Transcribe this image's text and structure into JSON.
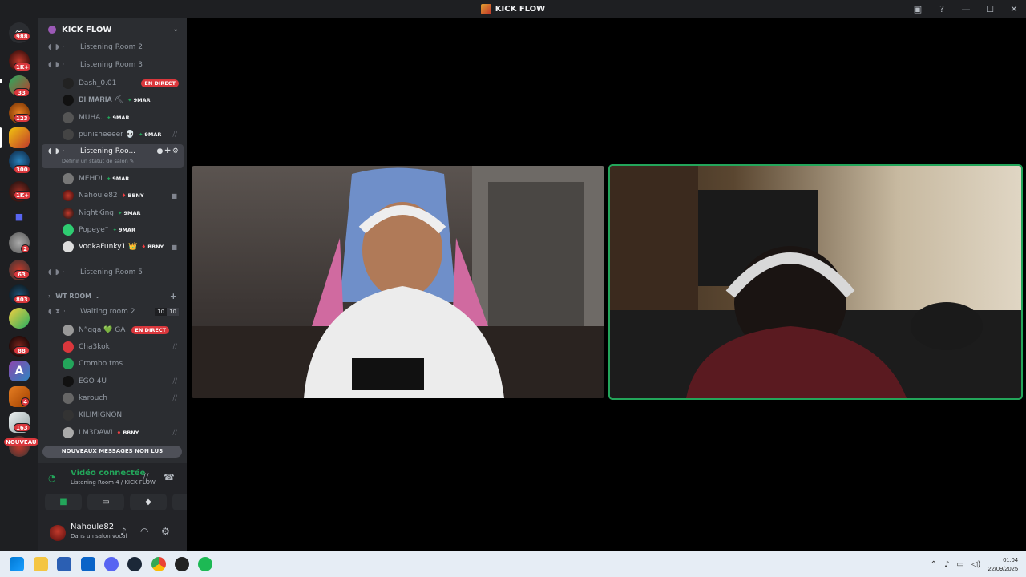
{
  "window": {
    "title": "KICK FLOW"
  },
  "servers": [
    {
      "name": "Discord home",
      "badge": "988"
    },
    {
      "name": "server-1",
      "badge": "1K+"
    },
    {
      "name": "server-2",
      "badge": "33"
    },
    {
      "name": "server-3",
      "badge": "123"
    },
    {
      "name": "KICK FLOW",
      "badge": ""
    },
    {
      "name": "server-5",
      "badge": "300"
    },
    {
      "name": "server-6",
      "badge": "1K+"
    },
    {
      "name": "folder",
      "badge": ""
    },
    {
      "name": "server-8",
      "badge": "2"
    },
    {
      "name": "server-9",
      "badge": "63"
    },
    {
      "name": "server-10",
      "badge": "803"
    },
    {
      "name": "server-11",
      "badge": ""
    },
    {
      "name": "server-12",
      "badge": "88"
    },
    {
      "name": "server-13",
      "badge": ""
    },
    {
      "name": "server-14",
      "badge": "4"
    },
    {
      "name": "server-15",
      "badge": "163"
    },
    {
      "name": "server-16",
      "badge": "NOUVEAU"
    }
  ],
  "guild": {
    "name": "KICK FLOW"
  },
  "channels": {
    "room2": "Listening Room 2",
    "room3": "Listening Room 3",
    "room3_users": [
      {
        "name": "Dash_0.01",
        "tag": "",
        "live": "EN DIRECT"
      },
      {
        "name": "𝐃𝐈 𝐌𝐀𝐑𝐈𝐀 ⛏",
        "tag": "9MAR",
        "live": ""
      },
      {
        "name": "MUHA.",
        "tag": "9MAR",
        "live": ""
      },
      {
        "name": "punisheeeer 💀",
        "tag": "9MAR",
        "live": ""
      }
    ],
    "room4": "Listening Roo...",
    "room4_status": "Définir un statut de salon ✎",
    "room4_users": [
      {
        "name": "MEHDI",
        "tag": "9MAR",
        "tagc": "g"
      },
      {
        "name": "Nahoule82",
        "tag": "BBNY",
        "tagc": "r"
      },
      {
        "name": "NightKing",
        "tag": "9MAR",
        "tagc": "g"
      },
      {
        "name": "Popeye⁼",
        "tag": "9MAR",
        "tagc": "g"
      },
      {
        "name": "VodkaFunky1 👑",
        "tag": "BBNY",
        "tagc": "r"
      }
    ],
    "room5": "Listening Room 5",
    "category": "WT ROOM",
    "waiting": "Waiting room 2",
    "waiting_count": "10",
    "waiting_limit": "10",
    "waiting_users": [
      {
        "name": "N”gga 💚 GA",
        "live": "EN DIRECT"
      },
      {
        "name": "Cha3kok",
        "live": ""
      },
      {
        "name": "Crombo tms",
        "live": ""
      },
      {
        "name": "EGO 4U",
        "live": ""
      },
      {
        "name": "karouch",
        "live": ""
      },
      {
        "name": "KILIMIGNON",
        "live": ""
      },
      {
        "name": "LM3DAWI",
        "live": "",
        "tag": "BBNY"
      }
    ],
    "unread": "NOUVEAUX MESSAGES NON LUS"
  },
  "voice": {
    "status": "Vidéo connectée",
    "location": "Listening Room 4 / KICK FLOW"
  },
  "user": {
    "name": "Nahoule82",
    "status": "Dans un salon vocal"
  },
  "clock": {
    "time": "01:04",
    "date": "22/09/2025"
  }
}
